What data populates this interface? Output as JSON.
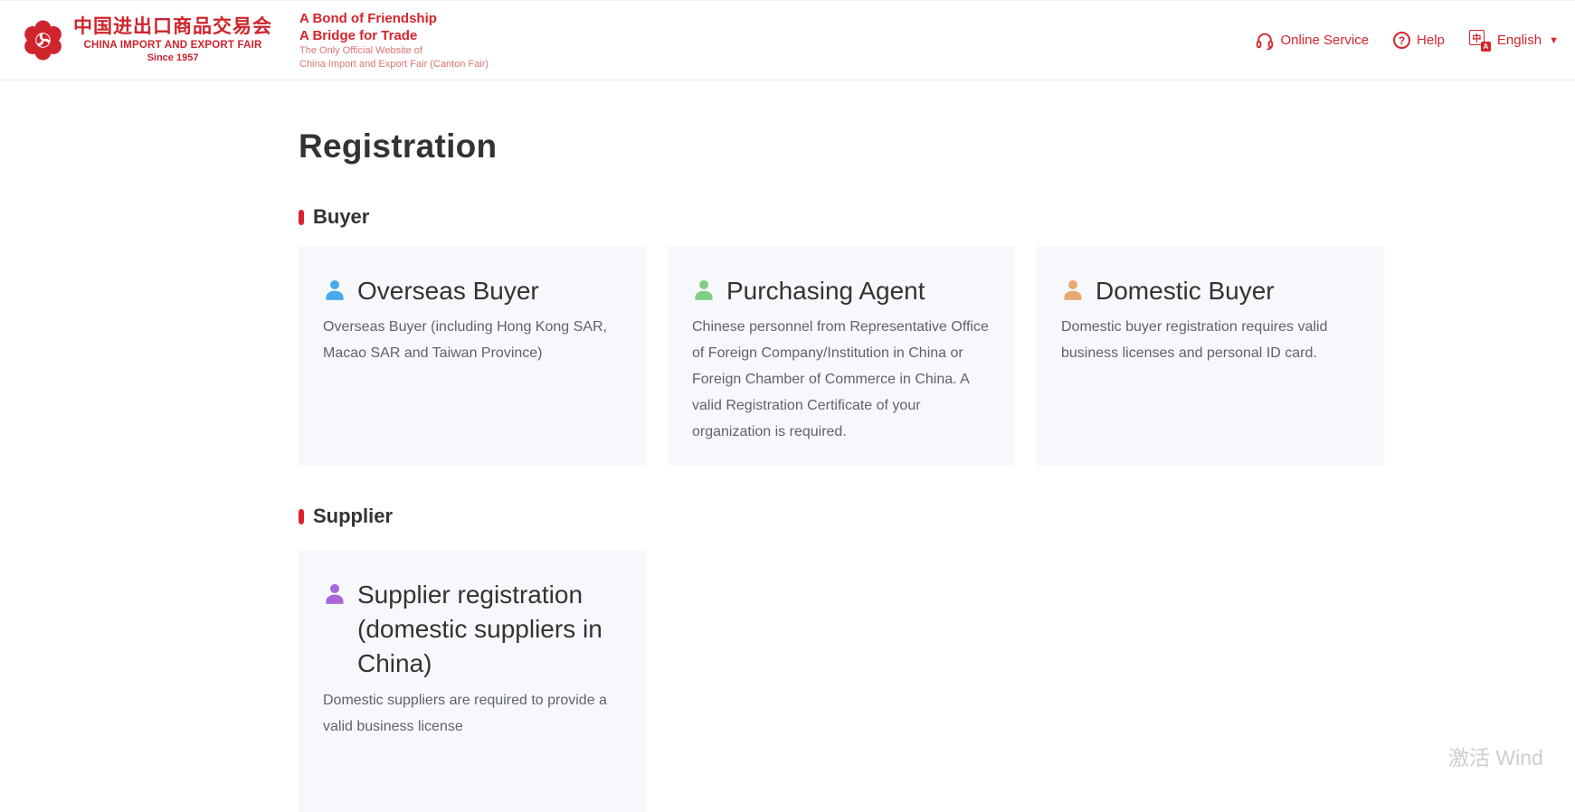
{
  "header": {
    "logo": {
      "cn": "中国进出口商品交易会",
      "en": "CHINA IMPORT AND EXPORT FAIR",
      "since": "Since 1957"
    },
    "tagline": {
      "line1": "A Bond of Friendship",
      "line2": "A Bridge for Trade",
      "sub1": "The Only Official Website of",
      "sub2": "China Import and Export Fair (Canton Fair)"
    },
    "nav": {
      "online_service": "Online Service",
      "help": "Help",
      "help_icon_glyph": "?",
      "language": "English",
      "language_arrow": "▼",
      "translate_icon_cn": "中",
      "translate_icon_en": "A"
    }
  },
  "page": {
    "title": "Registration",
    "sections": [
      {
        "label": "Buyer",
        "cards": [
          {
            "title": "Overseas Buyer",
            "description": "Overseas Buyer (including Hong Kong SAR, Macao SAR and Taiwan Province)",
            "icon": "person-icon",
            "icon_color": "#49a9ee"
          },
          {
            "title": "Purchasing Agent",
            "description": "Chinese personnel from Representative Office of Foreign Company/Institution in China or Foreign Chamber of Commerce in China. A valid Registration Certificate of your organization is required.",
            "icon": "person-icon",
            "icon_color": "#7fcd84"
          },
          {
            "title": "Domestic Buyer",
            "description": "Domestic buyer registration requires valid business licenses and personal ID card.",
            "icon": "person-icon",
            "icon_color": "#e8aa71"
          }
        ]
      },
      {
        "label": "Supplier",
        "cards": [
          {
            "title": "Supplier registration (domestic suppliers in China)",
            "description": "Domestic suppliers are required to provide a valid business license",
            "icon": "person-icon",
            "icon_color": "#a868da"
          }
        ]
      }
    ]
  },
  "watermark": "激活 Wind",
  "colors": {
    "brand_red": "#cf242c",
    "nav_red": "#d4252c",
    "section_bar_red": "#d9232e",
    "card_bg": "#f7f8fb",
    "title_text": "#333333",
    "desc_text": "#5f6368",
    "icon_blue": "#49a9ee",
    "icon_green": "#7fcd84",
    "icon_orange": "#e8aa71",
    "icon_purple": "#a868da"
  }
}
